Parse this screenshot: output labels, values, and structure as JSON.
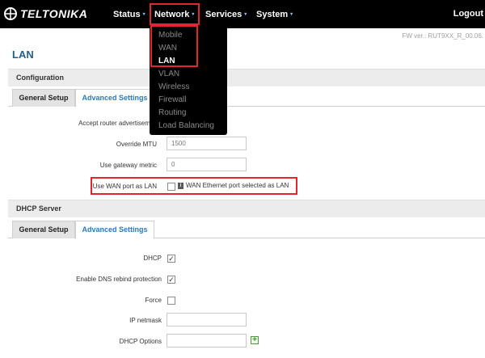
{
  "brand": {
    "name": "TELTONIKA"
  },
  "nav": {
    "status": "Status",
    "network": "Network",
    "services": "Services",
    "system": "System",
    "logout": "Logout"
  },
  "firmware": "FW ver.: RUT9XX_R_00.06.",
  "page_title": "LAN",
  "network_menu": [
    "Mobile",
    "WAN",
    "LAN",
    "VLAN",
    "Wireless",
    "Firewall",
    "Routing",
    "Load Balancing"
  ],
  "network_menu_active": "LAN",
  "configuration": {
    "title": "Configuration",
    "tabs": [
      "General Setup",
      "Advanced Settings"
    ],
    "fields": {
      "accept_ra": {
        "label": "Accept router advertisem"
      },
      "override_mtu": {
        "label": "Override MTU",
        "placeholder": "1500"
      },
      "gateway_metric": {
        "label": "Use gateway metric",
        "placeholder": "0"
      },
      "wan_as_lan": {
        "label": "Use WAN port as LAN",
        "hint": "WAN Ethernet port selected as LAN",
        "checked": false
      }
    }
  },
  "dhcp": {
    "title": "DHCP Server",
    "tabs": [
      "General Setup",
      "Advanced Settings"
    ],
    "fields": {
      "dhcp": {
        "label": "DHCP",
        "checked": true
      },
      "dns_rebind": {
        "label": "Enable DNS rebind protection",
        "checked": true
      },
      "force": {
        "label": "Force",
        "checked": false
      },
      "ip_netmask": {
        "label": "IP netmask",
        "value": ""
      },
      "dhcp_options": {
        "label": "DHCP Options",
        "value": ""
      }
    }
  },
  "glyphs": {
    "check": "✓",
    "caret": "▾",
    "plus": "+",
    "info": "i"
  },
  "colors": {
    "accent": "#2a7ab8",
    "title": "#1e5f8c",
    "highlight": "#e3262d",
    "topbar": "#000000"
  }
}
